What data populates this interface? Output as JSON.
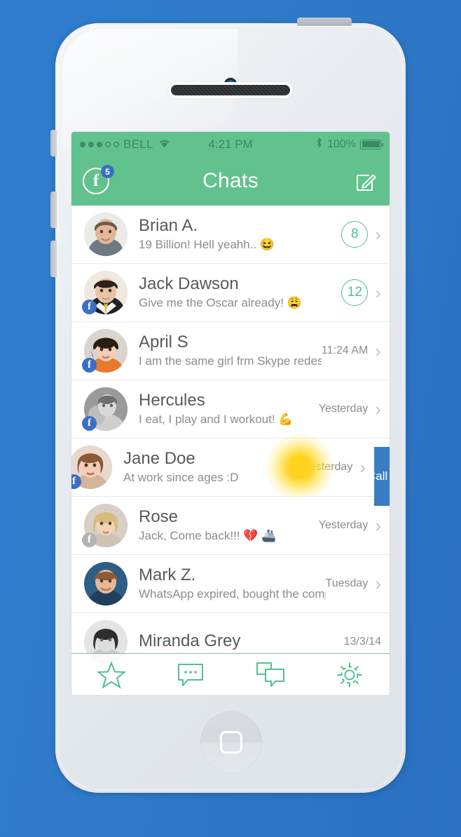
{
  "device": {
    "name": "white-smartphone",
    "buttons": [
      "power-button",
      "silent-switch",
      "volume-up-button",
      "volume-down-button",
      "home-button"
    ]
  },
  "statusbar": {
    "signal_dots_filled": 3,
    "signal_dots_total": 5,
    "carrier": "BELL",
    "wifi_icon": "wifi-icon",
    "time": "4:21 PM",
    "bluetooth_icon": "bluetooth-icon",
    "battery_percent": "100%",
    "battery_level": 100
  },
  "navbar": {
    "title": "Chats",
    "facebook_icon": "facebook-icon",
    "facebook_badge": "5",
    "compose_icon": "compose-icon",
    "bg_color": "#62c28e"
  },
  "chats": [
    {
      "name": "Brian A.",
      "message": "19 Billion! Hell yeahh.. 😆",
      "time": "",
      "unread": "8",
      "fb_badge": false,
      "fb_muted": false,
      "swiped": false
    },
    {
      "name": "Jack Dawson",
      "message": "Give me the Oscar already! 😩",
      "time": "",
      "unread": "12",
      "fb_badge": true,
      "fb_muted": false,
      "swiped": false
    },
    {
      "name": "April S",
      "message": "I am the same girl frm Skype redesign!",
      "time": "11:24 AM",
      "unread": "",
      "fb_badge": true,
      "fb_muted": false,
      "swiped": false
    },
    {
      "name": "Hercules",
      "message": "I eat, I play and I workout! 💪",
      "time": "Yesterday",
      "unread": "",
      "fb_badge": true,
      "fb_muted": false,
      "swiped": false
    },
    {
      "name": "Jane Doe",
      "message": "At work since ages :D",
      "time": "Yesterday",
      "unread": "",
      "fb_badge": true,
      "fb_muted": false,
      "swiped": true,
      "swipe_action_label": "Call",
      "swipe_action_color": "#3b7dc4",
      "touch_glow": true
    },
    {
      "name": "Rose",
      "message": "Jack, Come back!!! 💔 🚢",
      "time": "Yesterday",
      "unread": "",
      "fb_badge": true,
      "fb_muted": true,
      "swiped": false
    },
    {
      "name": "Mark Z.",
      "message": "WhatsApp expired, bought the company",
      "time": "Tuesday",
      "unread": "",
      "fb_badge": false,
      "fb_muted": false,
      "swiped": false
    },
    {
      "name": "Miranda Grey",
      "message": "",
      "time": "13/3/14",
      "unread": "",
      "fb_badge": false,
      "fb_muted": false,
      "swiped": false
    }
  ],
  "tabbar": {
    "accent_color": "#53c08a",
    "tabs": [
      {
        "icon": "star-icon",
        "label": "Favorites"
      },
      {
        "icon": "message-bubble-icon",
        "label": "Recents"
      },
      {
        "icon": "chats-bubbles-icon",
        "label": "Chats"
      },
      {
        "icon": "gear-icon",
        "label": "Settings"
      }
    ]
  },
  "theme": {
    "background_gradient_from": "#2e7dcc",
    "background_gradient_to": "#2a6fc0",
    "brand_green": "#62c28e",
    "facebook_blue": "#3b6fc4"
  }
}
